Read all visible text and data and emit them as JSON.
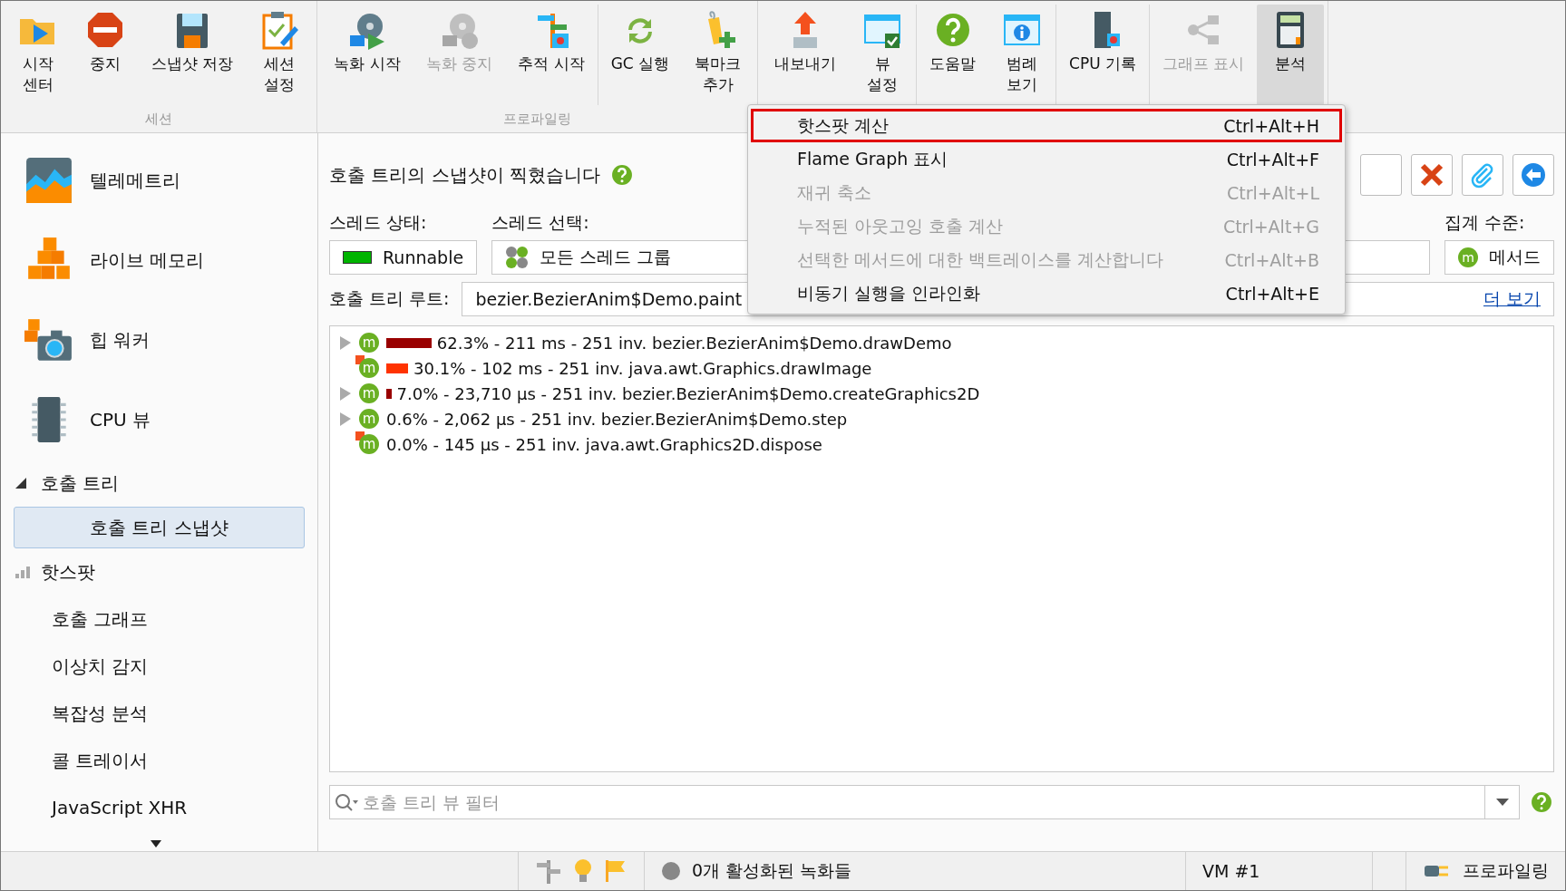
{
  "toolbar": {
    "groups": [
      {
        "label": "세션",
        "sections": [
          [
            {
              "label": "시작\n센터",
              "disabled": false,
              "pressed": false
            },
            {
              "label": "중지",
              "disabled": false,
              "pressed": false
            },
            {
              "label": "스냅샷 저장",
              "disabled": false,
              "pressed": false
            },
            {
              "label": "세션\n설정",
              "disabled": false,
              "pressed": false
            }
          ]
        ]
      },
      {
        "label": "프로파일링",
        "sections": [
          [
            {
              "label": "녹화 시작",
              "disabled": false,
              "pressed": false
            },
            {
              "label": "녹화 중지",
              "disabled": true,
              "pressed": false
            },
            {
              "label": "추적 시작",
              "disabled": false,
              "pressed": false
            }
          ],
          [
            {
              "label": "GC 실행",
              "disabled": false,
              "pressed": false
            },
            {
              "label": "북마크\n추가",
              "disabled": false,
              "pressed": false
            }
          ]
        ]
      },
      {
        "sections": [
          [
            {
              "label": "내보내기",
              "disabled": false,
              "pressed": false
            },
            {
              "label": "뷰\n설정",
              "disabled": false,
              "pressed": false
            }
          ],
          [
            {
              "label": "도움말",
              "disabled": false,
              "pressed": false
            },
            {
              "label": "범례\n보기",
              "disabled": false,
              "pressed": false
            }
          ],
          [
            {
              "label": "CPU 기록",
              "disabled": false,
              "pressed": false
            }
          ],
          [
            {
              "label": "그래프 표시",
              "disabled": true,
              "pressed": false
            },
            {
              "label": "분석",
              "disabled": false,
              "pressed": true
            }
          ]
        ]
      }
    ]
  },
  "sidebar": {
    "views": [
      {
        "label": "텔레메트리"
      },
      {
        "label": "라이브 메모리"
      },
      {
        "label": "힙 워커"
      },
      {
        "label": "CPU 뷰"
      }
    ],
    "tree": [
      {
        "label": "호출 트리",
        "expanded": true,
        "children": [
          {
            "label": "호출 트리 스냅샷",
            "selected": true
          }
        ]
      },
      {
        "label": "핫스팟",
        "kind": "hotspot"
      },
      {
        "label": "호출 그래프"
      },
      {
        "label": "이상치 감지"
      },
      {
        "label": "복잡성 분석"
      },
      {
        "label": "콜 트레이서"
      },
      {
        "label": "JavaScript XHR"
      }
    ]
  },
  "content": {
    "header": "호출 트리의 스냅샷이 찍혔습니다",
    "thread_status": {
      "label": "스레드 상태:",
      "value": "Runnable",
      "color": "#00b400"
    },
    "thread_selection": {
      "label": "스레드 선택:",
      "value": "모든 스레드 그룹"
    },
    "aggregation": {
      "label": "집계 수준:",
      "value": "메서드",
      "icon": "m"
    },
    "root": {
      "label": "호출 트리 루트:",
      "value": "bezier.BezierAnim$Demo.paint",
      "link": "더 보기"
    },
    "rows": [
      {
        "icon": "m",
        "text": "62.3% - 211 ms - 251 inv. bezier.BezierAnim$Demo.drawDemo",
        "expandable": true,
        "color": "#990000",
        "flagged": false
      },
      {
        "icon": "m",
        "text": "30.1% - 102 ms - 251 inv. java.awt.Graphics.drawImage",
        "expandable": false,
        "color": "#ff3300",
        "flagged": true
      },
      {
        "icon": "m",
        "text": "7.0% - 23,710 µs - 251 inv. bezier.BezierAnim$Demo.createGraphics2D",
        "expandable": true,
        "color": "#990000",
        "flagged": false
      },
      {
        "icon": "m",
        "text": "0.6% - 2,062 µs - 251 inv. bezier.BezierAnim$Demo.step",
        "expandable": true,
        "flagged": false
      },
      {
        "icon": "m",
        "text": "0.0% - 145 µs - 251 inv. java.awt.Graphics2D.dispose",
        "expandable": false,
        "flagged": true
      }
    ],
    "filter": {
      "placeholder": "호출 트리 뷰 필터"
    }
  },
  "menu": [
    {
      "label": "핫스팟 계산",
      "shortcut": "Ctrl+Alt+H",
      "disabled": false,
      "selected": true
    },
    {
      "label": "Flame Graph 표시",
      "shortcut": "Ctrl+Alt+F",
      "disabled": false,
      "selected": false
    },
    {
      "label": "재귀 축소",
      "shortcut": "Ctrl+Alt+L",
      "disabled": true,
      "selected": false
    },
    {
      "label": "누적된 아웃고잉 호출 계산",
      "shortcut": "Ctrl+Alt+G",
      "disabled": true,
      "selected": false
    },
    {
      "label": "선택한 메서드에 대한 백트레이스를 계산합니다",
      "shortcut": "Ctrl+Alt+B",
      "disabled": true,
      "selected": false
    },
    {
      "label": "비동기 실행을 인라인화",
      "shortcut": "Ctrl+Alt+E",
      "disabled": false,
      "selected": false
    }
  ],
  "status_bar": {
    "recordings": "0개 활성화된 녹화들",
    "vm": "VM #1",
    "mode": "프로파일링"
  }
}
